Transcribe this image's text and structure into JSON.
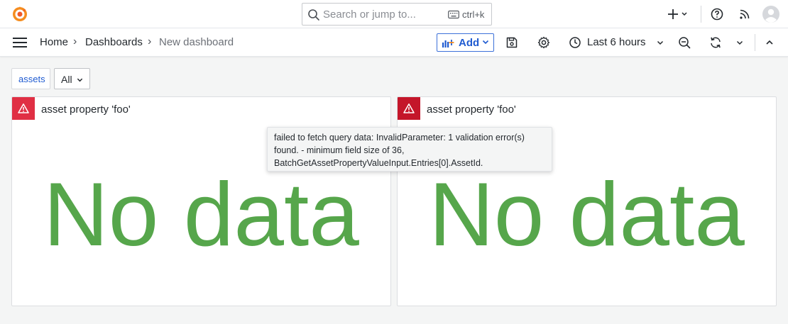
{
  "topbar": {
    "search_placeholder": "Search or jump to...",
    "shortcut": "ctrl+k"
  },
  "breadcrumb": {
    "home": "Home",
    "dashboards": "Dashboards",
    "current": "New dashboard"
  },
  "toolbar": {
    "add_label": "Add",
    "time_range": "Last 6 hours"
  },
  "variables": {
    "label": "assets",
    "value": "All"
  },
  "panels": [
    {
      "title": "asset property 'foo'",
      "message": "No data"
    },
    {
      "title": "asset property 'foo'",
      "message": "No data"
    }
  ],
  "tooltip": {
    "text": "failed to fetch query data: InvalidParameter: 1 validation error(s) found. - minimum field size of 36, BatchGetAssetPropertyValueInput.Entries[0].AssetId."
  },
  "colors": {
    "accent": "#1f5bd1",
    "nodata": "#56a64b",
    "error_left": "#e02f44",
    "error_right": "#c4162a",
    "logo": "#f05a28"
  },
  "icons": {
    "logo": "grafana-logo-icon",
    "search": "search-icon",
    "keyboard": "keyboard-icon",
    "plus": "plus-icon",
    "help": "help-icon",
    "news": "rss-icon",
    "avatar": "avatar-icon",
    "menu": "hamburger-menu-icon",
    "save": "save-icon",
    "settings": "gear-icon",
    "clock": "clock-icon",
    "zoom_out": "zoom-out-icon",
    "refresh": "refresh-icon",
    "collapse": "chevron-up-icon",
    "warning": "warning-icon"
  }
}
